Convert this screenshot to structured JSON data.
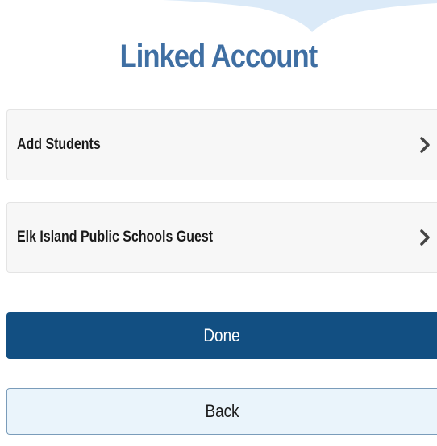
{
  "header": {
    "title": "Linked Account"
  },
  "accounts": {
    "items": [
      {
        "label": "Add Students",
        "icon": "chevron-right-icon"
      },
      {
        "label": "Elk Island Public Schools Guest",
        "icon": "chevron-right-icon"
      }
    ]
  },
  "actions": {
    "done_label": "Done",
    "back_label": "Back"
  },
  "colors": {
    "title": "#3f6fa3",
    "primary_button": "#124f82",
    "secondary_button": "#eaf4fb",
    "list_item_background": "#f7f7f7",
    "chevron": "#444444"
  }
}
